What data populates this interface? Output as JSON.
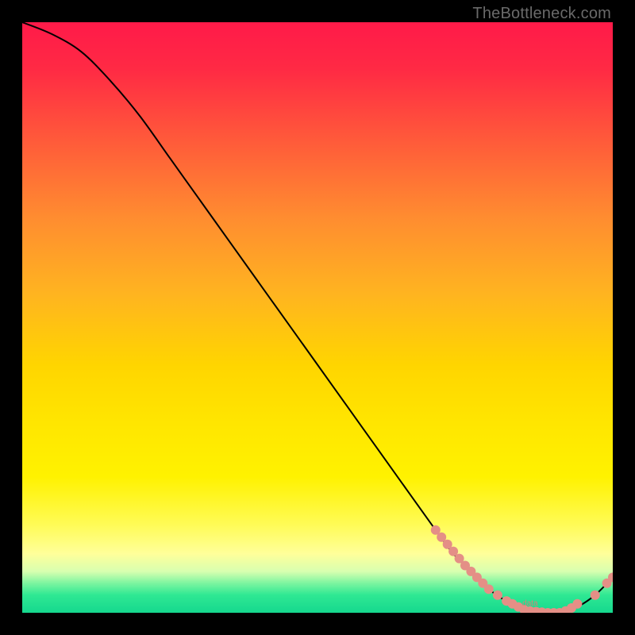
{
  "watermark": "TheBottleneck.com",
  "chart_data": {
    "type": "line",
    "title": "",
    "xlabel": "",
    "ylabel": "",
    "xlim": [
      0,
      100
    ],
    "ylim": [
      0,
      100
    ],
    "grid": false,
    "legend": false,
    "series": [
      {
        "name": "bottleneck-curve",
        "x": [
          0,
          5,
          10,
          15,
          20,
          25,
          30,
          35,
          40,
          45,
          50,
          55,
          60,
          65,
          70,
          73,
          76,
          79,
          82,
          85,
          88,
          91,
          94,
          97,
          100
        ],
        "y": [
          100,
          98,
          95,
          90,
          84,
          77,
          70,
          63,
          56,
          49,
          42,
          35,
          28,
          21,
          14,
          10,
          7,
          4,
          2,
          1,
          0,
          0,
          1,
          3,
          6
        ],
        "color": "#000000"
      }
    ],
    "markers": {
      "name": "highlight-points",
      "color": "#e48f86",
      "points": [
        {
          "x": 70,
          "y": 14
        },
        {
          "x": 71,
          "y": 12.8
        },
        {
          "x": 72,
          "y": 11.6
        },
        {
          "x": 73,
          "y": 10.4
        },
        {
          "x": 74,
          "y": 9.2
        },
        {
          "x": 75,
          "y": 8
        },
        {
          "x": 76,
          "y": 7
        },
        {
          "x": 77,
          "y": 6
        },
        {
          "x": 78,
          "y": 5
        },
        {
          "x": 79,
          "y": 4
        },
        {
          "x": 80.5,
          "y": 3
        },
        {
          "x": 82,
          "y": 2
        },
        {
          "x": 83,
          "y": 1.5
        },
        {
          "x": 84,
          "y": 1
        },
        {
          "x": 85,
          "y": 0.5
        },
        {
          "x": 86,
          "y": 0.3
        },
        {
          "x": 87,
          "y": 0.2
        },
        {
          "x": 88,
          "y": 0.1
        },
        {
          "x": 89,
          "y": 0
        },
        {
          "x": 90,
          "y": 0
        },
        {
          "x": 91,
          "y": 0
        },
        {
          "x": 92,
          "y": 0.3
        },
        {
          "x": 93,
          "y": 0.8
        },
        {
          "x": 94,
          "y": 1.5
        },
        {
          "x": 97,
          "y": 3
        },
        {
          "x": 99,
          "y": 5
        },
        {
          "x": 100,
          "y": 6
        }
      ]
    },
    "annotations": [
      {
        "name": "cluster-label",
        "text": "data",
        "x": 86,
        "y": 1.2,
        "color": "#d97f78"
      }
    ]
  }
}
